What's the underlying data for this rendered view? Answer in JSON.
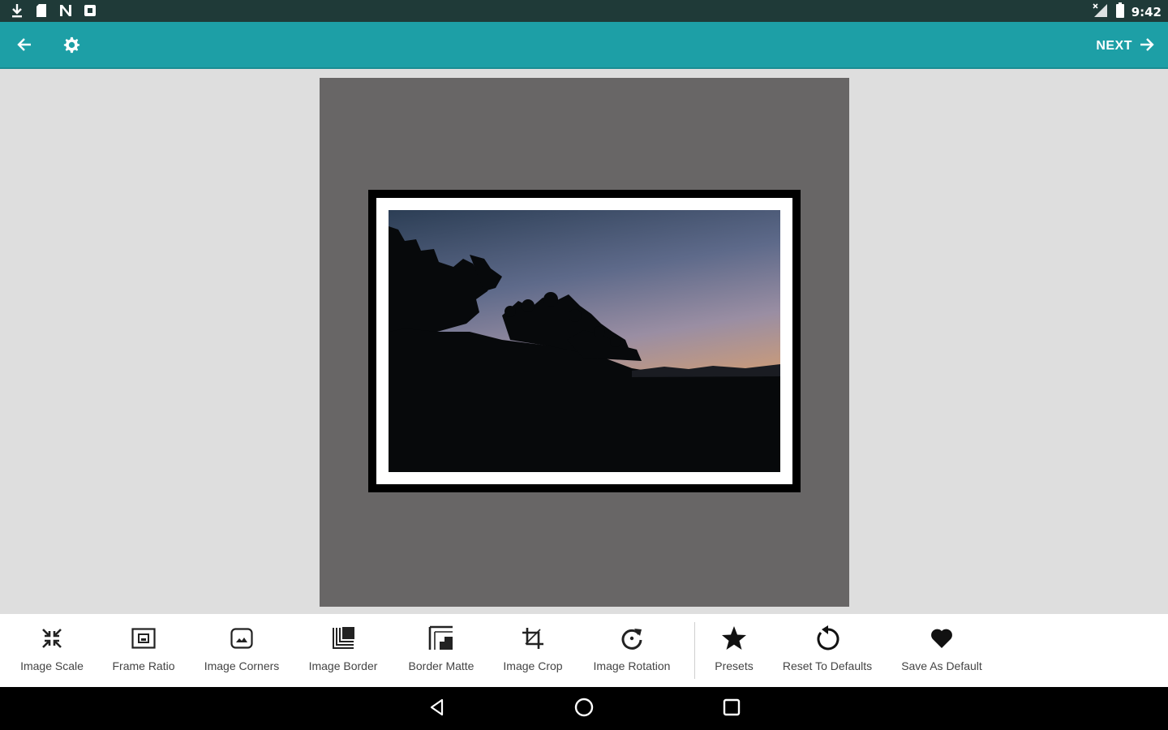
{
  "status_bar": {
    "time": "9:42",
    "left_icons": [
      "download-icon",
      "sd-card-icon",
      "n-notification-icon",
      "square-notification-icon"
    ],
    "right_icons": [
      "signal-icon",
      "battery-icon"
    ]
  },
  "app_bar": {
    "background_color": "#1d9fa6",
    "next_label": "NEXT",
    "back_icon": "arrow-left-icon",
    "settings_icon": "gear-icon",
    "next_icon": "arrow-right-icon"
  },
  "canvas": {
    "frame_background_color": "#686666",
    "border_color": "#000000",
    "matte_color": "#ffffff"
  },
  "toolbar": {
    "tools": [
      {
        "label": "Image Scale",
        "icon": "scale-arrows-icon"
      },
      {
        "label": "Frame Ratio",
        "icon": "frame-ratio-icon"
      },
      {
        "label": "Image Corners",
        "icon": "image-corners-icon"
      },
      {
        "label": "Image Border",
        "icon": "image-border-icon"
      },
      {
        "label": "Border Matte",
        "icon": "border-matte-icon"
      },
      {
        "label": "Image Crop",
        "icon": "crop-icon"
      },
      {
        "label": "Image Rotation",
        "icon": "rotate-icon"
      }
    ],
    "actions": [
      {
        "label": "Presets",
        "icon": "star-icon"
      },
      {
        "label": "Reset To Defaults",
        "icon": "reset-icon"
      },
      {
        "label": "Save As Default",
        "icon": "heart-icon"
      }
    ]
  },
  "nav_bar": {
    "buttons": [
      "back-triangle-icon",
      "home-circle-icon",
      "recents-square-icon"
    ]
  }
}
